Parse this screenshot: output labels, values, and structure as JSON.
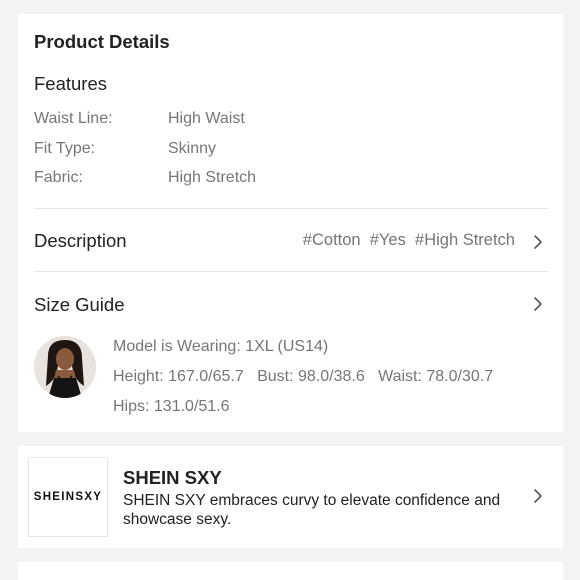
{
  "product_details": {
    "title": "Product Details",
    "features": {
      "title": "Features",
      "rows": [
        {
          "key": "Waist Line:",
          "value": "High Waist"
        },
        {
          "key": "Fit Type:",
          "value": "Skinny"
        },
        {
          "key": "Fabric:",
          "value": "High Stretch"
        }
      ]
    },
    "description": {
      "label": "Description",
      "tags": "#Cotton  #Yes  #High Stretch"
    },
    "size_guide": {
      "label": "Size Guide",
      "model_wearing": "Model is Wearing: 1XL (US14)",
      "measurements": "Height: 167.0/65.7   Bust: 98.0/38.6   Waist: 78.0/30.7",
      "hips": "Hips: 131.0/51.6"
    }
  },
  "brand": {
    "logo_text": "SHEINSXY",
    "name": "SHEIN SXY",
    "description": "SHEIN SXY embraces curvy to elevate confidence and showcase sexy."
  },
  "icons": {
    "description_chevron": "chevron-right-icon",
    "size_guide_chevron": "chevron-right-icon",
    "brand_chevron": "chevron-right-icon"
  },
  "colors": {
    "background": "#f3f3f3",
    "card": "#ffffff",
    "primary_text": "#222222",
    "secondary_text": "#767676",
    "divider": "#e6e6e6"
  }
}
